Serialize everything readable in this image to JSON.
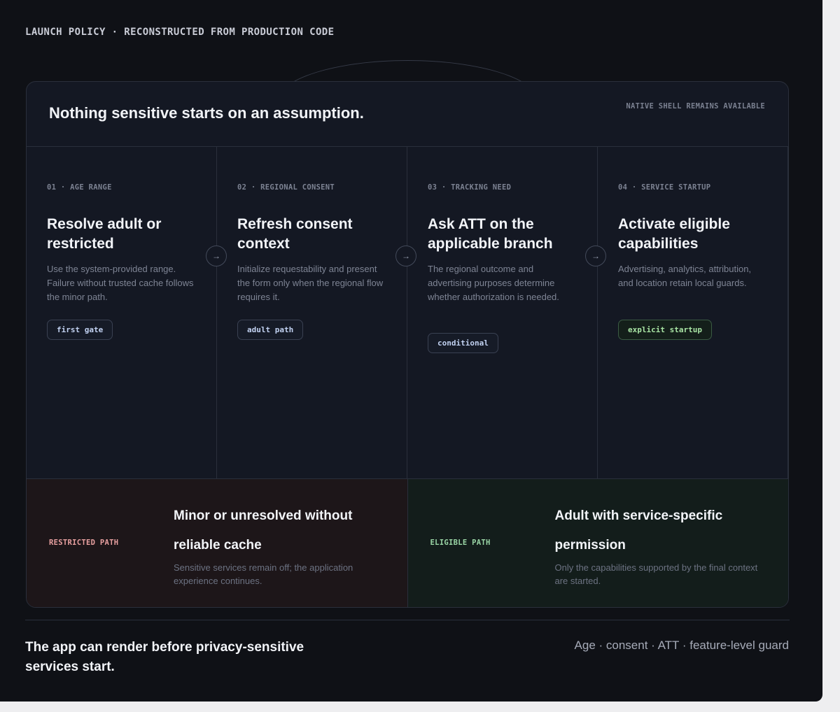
{
  "eyebrow": "LAUNCH POLICY · RECONSTRUCTED FROM PRODUCTION CODE",
  "card": {
    "title": "Nothing sensitive starts on an assumption.",
    "note": "NATIVE SHELL REMAINS AVAILABLE"
  },
  "steps": [
    {
      "eyebrow": "01 · AGE RANGE",
      "heading": "Resolve adult or restricted",
      "body": "Use the system-provided range. Failure without trusted cache follows the minor path.",
      "tag": "first gate",
      "tag_color": "#b8c7ea"
    },
    {
      "eyebrow": "02 · REGIONAL CONSENT",
      "heading": "Refresh consent context",
      "body": "Initialize requestability and present the form only when the regional flow requires it.",
      "tag": "adult path",
      "tag_color": "#c2d2f2"
    },
    {
      "eyebrow": "03 · TRACKING NEED",
      "heading": "Ask ATT on the applicable branch",
      "body": "The regional outcome and advertising purposes determine whether authorization is needed.",
      "tag": "conditional",
      "tag_color": "#c2d2f2"
    },
    {
      "eyebrow": "04 · SERVICE STARTUP",
      "heading": "Activate eligible capabilities",
      "body": "Advertising, analytics, attribution, and location retain local guards.",
      "tag": "explicit startup",
      "tag_color": "#a8e4a4"
    }
  ],
  "connector_icon": "arrow-right-icon",
  "connector_glyph": "→",
  "paths": {
    "restricted": {
      "label": "RESTRICTED PATH",
      "heading": "Minor or unresolved without reliable cache",
      "body": "Sensitive services remain off; the application experience continues.",
      "color": "#e8a0a0"
    },
    "eligible": {
      "label": "ELIGIBLE PATH",
      "heading": "Adult with service-specific permission",
      "body": "Only the capabilities supported by the final context are started.",
      "color": "#9ad6a6"
    }
  },
  "footer": {
    "text": "The app can render before privacy-sensitive services start.",
    "meta": "Age · consent · ATT · feature-level guard"
  }
}
